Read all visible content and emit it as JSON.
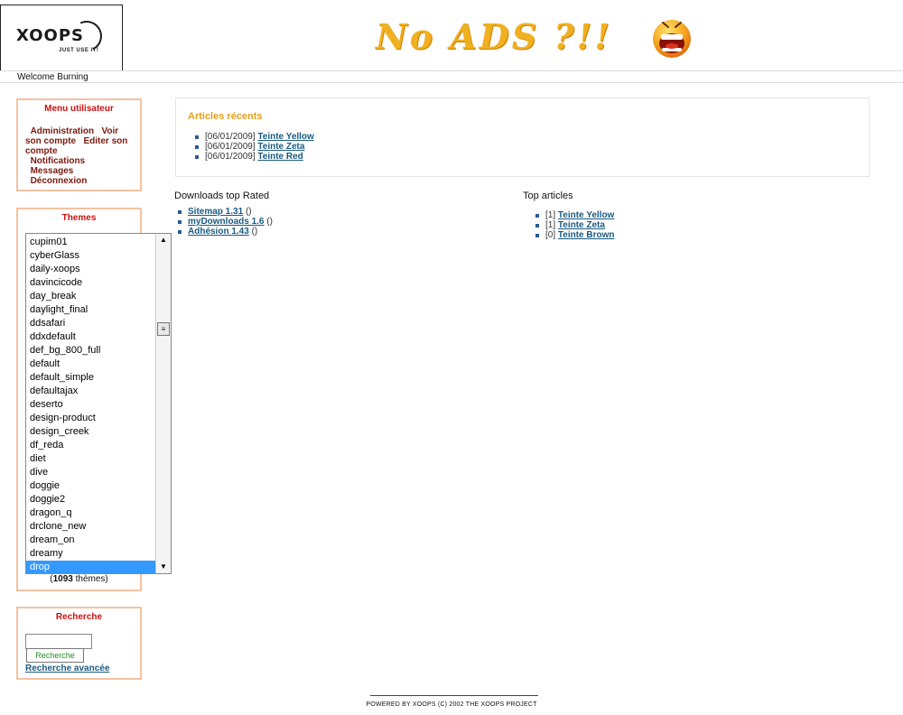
{
  "header": {
    "logo_text": "XOOPS",
    "logo_tagline": "JUST USE IT!",
    "banner_text": "No ADS ?!!",
    "welcome": "Welcome Burning"
  },
  "user_menu": {
    "title": "Menu utilisateur",
    "items": [
      "Administration",
      "Voir son compte",
      "Editer son compte",
      "Notifications",
      "Messages",
      "Déconnexion"
    ]
  },
  "themes": {
    "title": "Themes",
    "options": [
      "cupim01",
      "cyberGlass",
      "daily-xoops",
      "davincicode",
      "day_break",
      "daylight_final",
      "ddsafari",
      "ddxdefault",
      "def_bg_800_full",
      "default",
      "default_simple",
      "defaultajax",
      "deserto",
      "design-product",
      "design_creek",
      "df_reda",
      "diet",
      "dive",
      "doggie",
      "doggie2",
      "dragon_q",
      "drclone_new",
      "dream_on",
      "dreamy",
      "drop"
    ],
    "selected": "drop",
    "count_number": "1093",
    "count_label": " thèmes)",
    "count_prefix": "("
  },
  "search": {
    "title": "Recherche",
    "button": "Recherche",
    "advanced": "Recherche avancée",
    "input_value": ""
  },
  "recent_articles": {
    "title": "Articles récents",
    "items": [
      {
        "date": "[06/01/2009]",
        "title": "Teinte Yellow"
      },
      {
        "date": "[06/01/2009]",
        "title": "Teinte Zeta"
      },
      {
        "date": "[06/01/2009]",
        "title": "Teinte Red"
      }
    ]
  },
  "downloads": {
    "title": "Downloads top Rated",
    "items": [
      {
        "title": "Sitemap 1.31",
        "extra": "()"
      },
      {
        "title": "myDownloads 1.6",
        "extra": "()"
      },
      {
        "title": "Adhésion 1.43",
        "extra": "()"
      }
    ]
  },
  "top_articles": {
    "title": "Top articles",
    "items": [
      {
        "rank": "[1]",
        "title": "Teinte Yellow"
      },
      {
        "rank": "[1]",
        "title": "Teinte Zeta"
      },
      {
        "rank": "[0]",
        "title": "Teinte Brown"
      }
    ]
  },
  "footer": {
    "text": "POWERED BY XOOPS (C) 2002 THE XOOPS PROJECT"
  },
  "colors": {
    "block_border": "#f3c2a0",
    "block_title": "#cc1111",
    "link": "#1a5a80",
    "section_title": "#e2a020",
    "selection": "#3399ff"
  }
}
